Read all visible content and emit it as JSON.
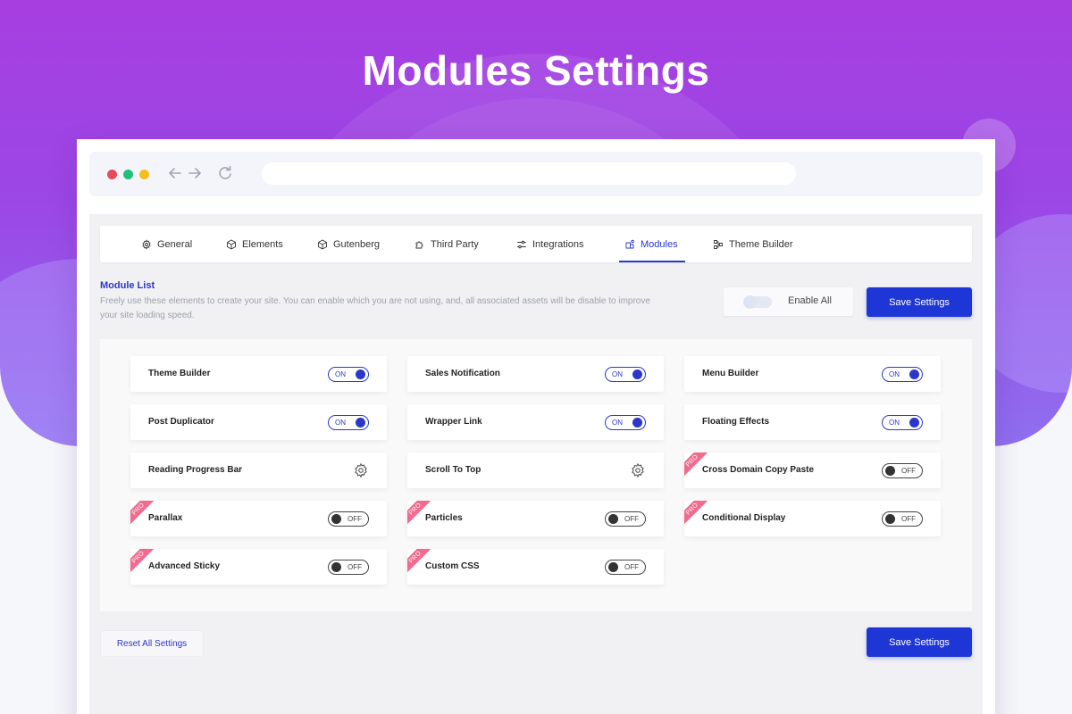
{
  "hero": {
    "title": "Modules Settings"
  },
  "tabs": [
    {
      "label": "General",
      "icon": "gear-icon"
    },
    {
      "label": "Elements",
      "icon": "cube-icon"
    },
    {
      "label": "Gutenberg",
      "icon": "cube-icon"
    },
    {
      "label": "Third Party",
      "icon": "puzzle-icon"
    },
    {
      "label": "Integrations",
      "icon": "sliders-icon"
    },
    {
      "label": "Modules",
      "icon": "modules-icon",
      "active": true
    },
    {
      "label": "Theme Builder",
      "icon": "flow-icon"
    }
  ],
  "module_list": {
    "title": "Module List",
    "description": "Freely use these elements to create your site. You can enable which you are not using, and, all associated assets will be disable to improve your site loading speed."
  },
  "enable_all": {
    "label": "Enable All",
    "state": "off"
  },
  "buttons": {
    "save_top": "Save Settings",
    "save_bottom": "Save Settings",
    "reset": "Reset All Settings"
  },
  "modules": [
    {
      "name": "Theme Builder",
      "control": "toggle",
      "state": "ON"
    },
    {
      "name": "Sales Notification",
      "control": "toggle",
      "state": "ON"
    },
    {
      "name": "Menu Builder",
      "control": "toggle",
      "state": "ON"
    },
    {
      "name": "Post Duplicator",
      "control": "toggle",
      "state": "ON"
    },
    {
      "name": "Wrapper Link",
      "control": "toggle",
      "state": "ON"
    },
    {
      "name": "Floating Effects",
      "control": "toggle",
      "state": "ON"
    },
    {
      "name": "Reading Progress Bar",
      "control": "settings",
      "icon": "gear-icon"
    },
    {
      "name": "Scroll To Top",
      "control": "settings",
      "icon": "gear-icon"
    },
    {
      "name": "Cross Domain Copy Paste",
      "control": "toggle",
      "state": "OFF",
      "pro": "PRO"
    },
    {
      "name": "Parallax",
      "control": "toggle",
      "state": "OFF",
      "pro": "PRO"
    },
    {
      "name": "Particles",
      "control": "toggle",
      "state": "OFF",
      "pro": "PRO"
    },
    {
      "name": "Conditional Display",
      "control": "toggle",
      "state": "OFF",
      "pro": "PRO"
    },
    {
      "name": "Advanced Sticky",
      "control": "toggle",
      "state": "OFF",
      "pro": "PRO"
    },
    {
      "name": "Custom CSS",
      "control": "toggle",
      "state": "OFF",
      "pro": "PRO"
    }
  ],
  "colors": {
    "accent": "#2a38c7",
    "primary_button": "#1f36d6",
    "pro_ribbon": "#f26a8d",
    "hero_top": "#a73ee0",
    "hero_bottom": "#8f6ff0"
  }
}
